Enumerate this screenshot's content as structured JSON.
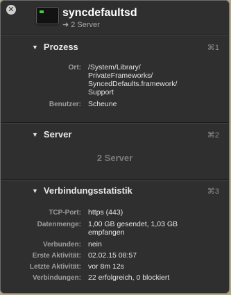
{
  "header": {
    "title": "syncdefaultsd",
    "subtitle": "2 Server",
    "close_glyph": "✕",
    "arrow_glyph": "➜"
  },
  "sections": {
    "prozess": {
      "title": "Prozess",
      "shortcut": "⌘1",
      "ort_label": "Ort:",
      "ort_lines": [
        "/System/Library/",
        "PrivateFrameworks/",
        "SyncedDefaults.framework/",
        "Support"
      ],
      "benutzer_label": "Benutzer:",
      "benutzer_value": "Scheune"
    },
    "server": {
      "title": "Server",
      "shortcut": "⌘2",
      "placeholder": "2 Server"
    },
    "statistik": {
      "title": "Verbindungsstatistik",
      "shortcut": "⌘3",
      "rows": [
        {
          "label": "TCP-Port:",
          "value": "https (443)"
        },
        {
          "label": "Datenmenge:",
          "value": "1,00 GB gesendet, 1,03 GB",
          "value2": "empfangen"
        },
        {
          "label": "Verbunden:",
          "value": "nein"
        },
        {
          "label": "Erste Aktivität:",
          "value": "02.02.15 08:57"
        },
        {
          "label": "Letzte Aktivität:",
          "value": "vor 8m 12s"
        },
        {
          "label": "Verbindungen:",
          "value": "22 erfolgreich, 0 blockiert"
        }
      ]
    }
  },
  "icons": {
    "close": "close-icon",
    "app": "terminal-icon",
    "disclosure": "disclosure-triangle-icon",
    "arrow": "arrow-right-icon"
  },
  "colors": {
    "panel_bg": "#2f2f2f",
    "label": "#9e9e9e",
    "value": "#e6e6e6"
  }
}
